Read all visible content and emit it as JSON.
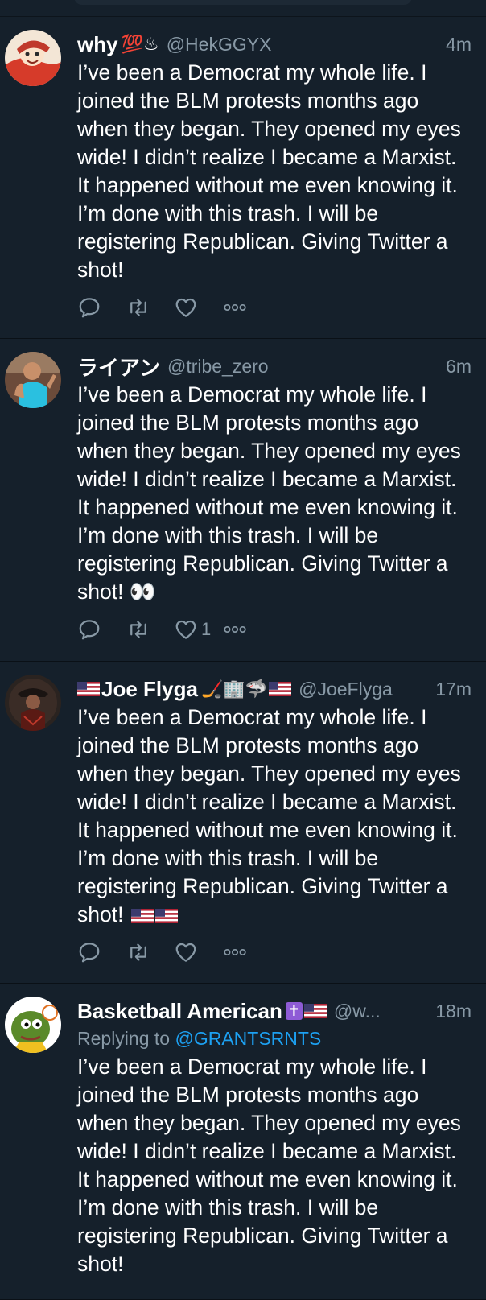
{
  "tweets": [
    {
      "name": "why",
      "name_emoji": "💯♨",
      "handle": "@HekGGYX",
      "time": "4m",
      "text": "I’ve been a Democrat my whole life. I joined the BLM protests months ago when they began. They opened my eyes wide! I didn’t realize I became a Marxist. It happened without me even knowing it. I’m done with this trash. I will be registering Republican. Giving Twitter a shot!",
      "likes": ""
    },
    {
      "name": "ライアン",
      "handle": "@tribe_zero",
      "time": "6m",
      "text": "I’ve been a Democrat my whole life. I joined the BLM protests months ago when they began. They opened my eyes wide! I didn’t realize I became a Marxist. It happened without me even knowing it. I’m done with this trash. I will be registering Republican. Giving Twitter a shot!",
      "text_emoji": "👀",
      "likes": "1"
    },
    {
      "name": "Joe Flyga",
      "name_emoji": "🏒🏢🦈",
      "handle": "@JoeFlyga",
      "time": "17m",
      "text": "I’ve been a Democrat my whole life. I joined the BLM protests months ago when they began. They opened my eyes wide! I didn’t realize I became a Marxist. It happened without me even knowing it. I’m done with this trash. I will be registering Republican. Giving Twitter a shot!",
      "likes": ""
    },
    {
      "name": "Basketball American",
      "name_emoji": "✝",
      "handle": "@w...",
      "time": "18m",
      "reply_prefix": "Replying to",
      "reply_to": "@GRANTSRNTS",
      "text": "I’ve been a Democrat my whole life. I joined the BLM protests months ago when they began. They opened my eyes wide! I didn’t realize I became a Marxist. It happened without me even knowing it. I’m done with this trash. I will be registering Republican. Giving Twitter a shot!",
      "likes": ""
    }
  ],
  "colors": {
    "background": "#15202b",
    "secondary_text": "#8899a6",
    "link": "#1da1f2"
  },
  "icons": [
    "reply-icon",
    "retweet-icon",
    "like-icon",
    "more-icon",
    "us-flag-icon"
  ]
}
